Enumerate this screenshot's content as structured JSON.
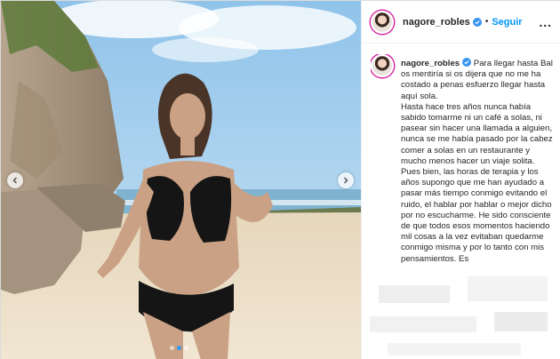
{
  "header": {
    "username": "nagore_robles",
    "separator": "•",
    "follow_label": "Seguir",
    "more_label": "..."
  },
  "caption": {
    "username": "nagore_robles",
    "paragraphs": [
      "Para llegar hasta Bali os mentiría si os dijera que no me ha costado a penas esfuerzo llegar hasta aquí sola.",
      "Hasta hace tres años nunca había sabido tomarme ni un café a solas, ni pasear sin hacer una llamada a alguien, nunca se me había pasado por la cabeza comer a solas en un restaurante y mucho menos hacer un viaje solita.",
      "Pues bien, las horas de terapia y los años supongo que me han ayudado a pasar más tiempo conmigo evitando el ruido, el hablar por hablar o mejor dicho por no escucharme. He sido consciente de que todos esos momentos haciendo mil cosas a la vez evitaban quedarme conmigo misma y por lo tanto con mis pensamientos. Es"
    ]
  },
  "carousel": {
    "slide_count": 3,
    "active_index": 1
  },
  "colors": {
    "link_blue": "#0095f6",
    "verified_blue": "#3897f0",
    "text": "#262626"
  }
}
